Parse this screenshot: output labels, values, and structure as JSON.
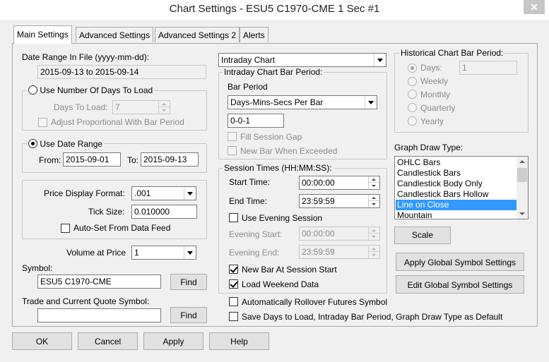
{
  "window": {
    "title": "Chart Settings - ESU5 C1970-CME  1 Sec   #1",
    "close_glyph": "✕"
  },
  "tabs": [
    "Main Settings",
    "Advanced Settings",
    "Advanced Settings 2",
    "Alerts"
  ],
  "left": {
    "date_range_label": "Date Range In File (yyyy-mm-dd):",
    "date_range_value": "2015-09-13 to 2015-09-14",
    "use_days_label": "Use Number Of Days To Load",
    "days_to_load_label": "Days To Load:",
    "days_to_load_value": "7",
    "adjust_proportional_label": "Adjust Proportional With Bar Period",
    "use_date_range_label": "Use Date Range",
    "from_label": "From:",
    "from_value": "2015-09-01",
    "to_label": "To:",
    "to_value": "2015-09-13",
    "price_format_label": "Price Display Format:",
    "price_format_value": ".001",
    "tick_size_label": "Tick Size:",
    "tick_size_value": "0.010000",
    "auto_set_label": "Auto-Set From Data Feed",
    "volume_at_price_label": "Volume at Price",
    "volume_at_price_value": "1",
    "symbol_label": "Symbol:",
    "symbol_value": "ESU5 C1970-CME",
    "find_label": "Find",
    "trade_quote_label": "Trade and Current Quote Symbol:",
    "trade_quote_value": "",
    "find2_label": "Find"
  },
  "middle": {
    "chart_type_value": "Intraday Chart",
    "bar_period_group": "Intraday Chart Bar Period:",
    "bar_period_label": "Bar Period",
    "bar_period_type": "Days-Mins-Secs Per Bar",
    "bar_period_value": "0-0-1",
    "fill_gap_label": "Fill Session Gap",
    "new_bar_exceeded_label": "New Bar When Exceeded",
    "session_group": "Session Times (HH:MM:SS):",
    "start_time_label": "Start Time:",
    "start_time_value": "00:00:00",
    "end_time_label": "End Time:",
    "end_time_value": "23:59:59",
    "evening_session_label": "Use Evening Session",
    "evening_start_label": "Evening Start:",
    "evening_start_value": "00:00:00",
    "evening_end_label": "Evening End:",
    "evening_end_value": "23:59:59",
    "new_bar_session_label": "New Bar At Session Start",
    "load_weekend_label": "Load Weekend Data",
    "auto_rollover_label": "Automatically Rollover Futures Symbol",
    "save_default_label": "Save Days to Load, Intraday Bar Period, Graph Draw Type as Default"
  },
  "right": {
    "hist_group": "Historical Chart Bar Period:",
    "days_label": "Days:",
    "days_value": "1",
    "weekly_label": "Weekly",
    "monthly_label": "Monthly",
    "quarterly_label": "Quarterly",
    "yearly_label": "Yearly",
    "graph_draw_label": "Graph Draw Type:",
    "graph_draw_items": [
      "OHLC Bars",
      "Candlestick Bars",
      "Candlestick Body Only",
      "Candlestick Bars Hollow",
      "Line on Close",
      "Mountain"
    ],
    "scale_label": "Scale",
    "apply_global_label": "Apply Global Symbol Settings",
    "edit_global_label": "Edit Global Symbol Settings"
  },
  "footer": {
    "ok": "OK",
    "cancel": "Cancel",
    "apply": "Apply",
    "help": "Help"
  },
  "colors": {
    "selection": "#3399ff",
    "window_bg": "#f0f0f0"
  }
}
